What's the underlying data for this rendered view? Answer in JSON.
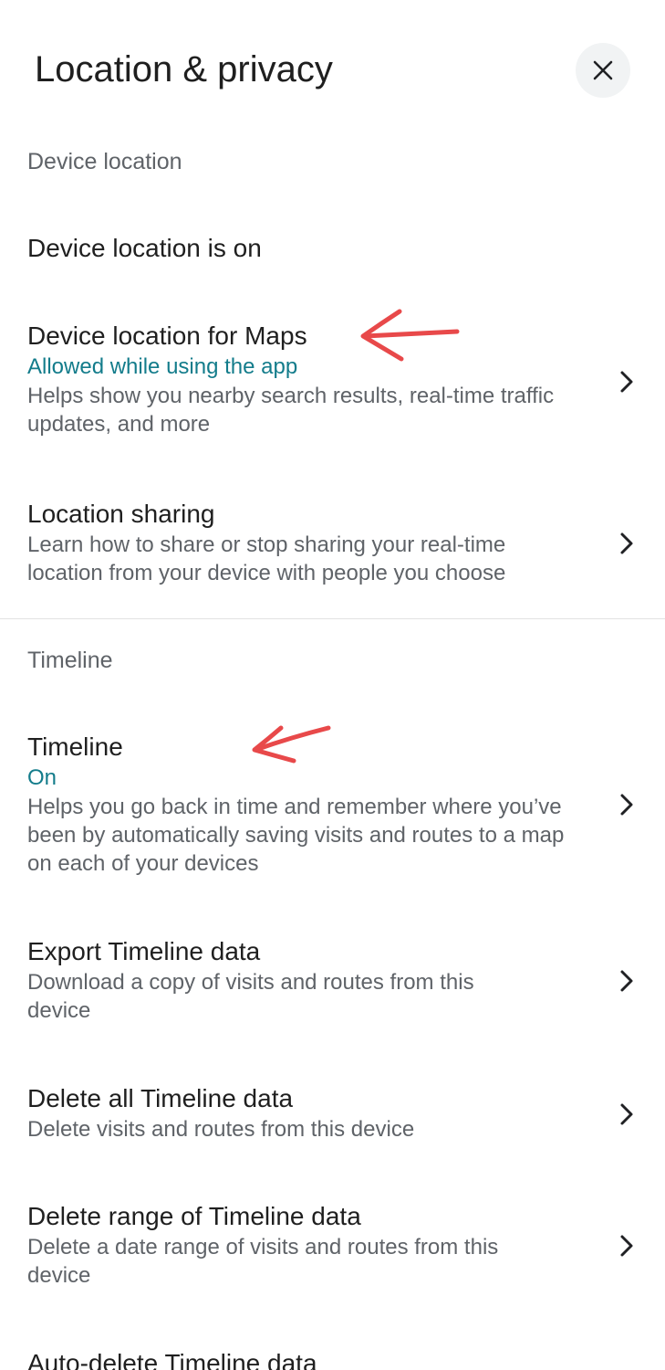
{
  "header": {
    "title": "Location & privacy",
    "close_icon": "close-icon"
  },
  "sections": {
    "device_location": {
      "header": "Device location",
      "status_row": {
        "title": "Device location is on"
      },
      "maps_row": {
        "title": "Device location for Maps",
        "status": "Allowed while using the app",
        "description": "Helps show you nearby search results, real-time traffic updates, and more"
      },
      "sharing_row": {
        "title": "Location sharing",
        "description": "Learn how to share or stop sharing your real-time location from your device with people you choose"
      }
    },
    "timeline": {
      "header": "Timeline",
      "timeline_row": {
        "title": "Timeline",
        "status": "On",
        "description": "Helps you go back in time and remember where you’ve been by automatically saving visits and routes to a map on each of your devices"
      },
      "export_row": {
        "title": "Export Timeline data",
        "description": "Download a copy of visits and routes from this device"
      },
      "delete_all_row": {
        "title": "Delete all Timeline data",
        "description": "Delete visits and routes from this device"
      },
      "delete_range_row": {
        "title": "Delete range of Timeline data",
        "description": "Delete a date range of visits and routes from this device"
      },
      "auto_delete_row": {
        "title": "Auto-delete Timeline data"
      }
    }
  },
  "colors": {
    "status_accent": "#137c8b",
    "annotation_arrow": "#e8494a",
    "secondary_text": "#5f6368",
    "close_button_bg": "#f1f3f4"
  },
  "icons": {
    "chevron": "chevron-right-icon",
    "annotation": "red-arrow-annotation"
  }
}
